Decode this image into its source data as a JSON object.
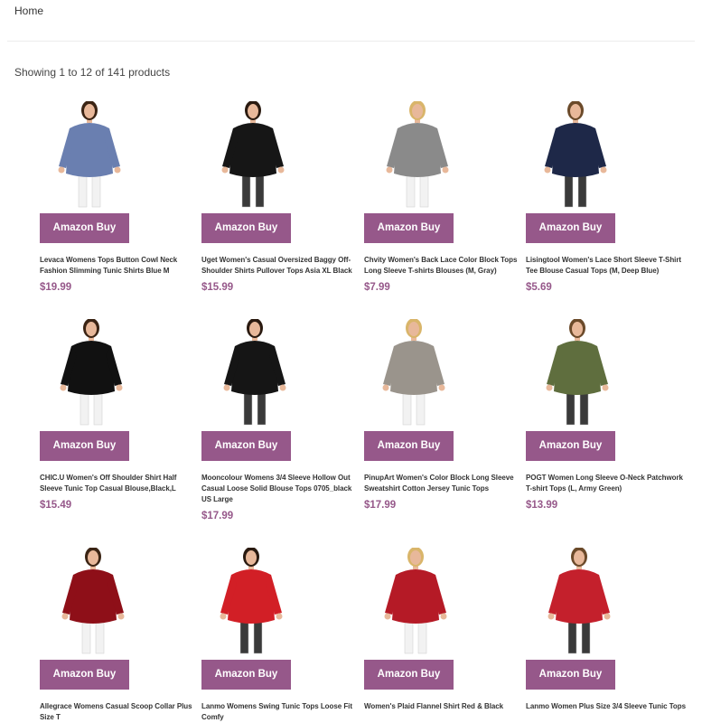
{
  "breadcrumb": {
    "home": "Home"
  },
  "results": {
    "summary": "Showing 1 to 12 of 141 products"
  },
  "buy_label": "Amazon Buy",
  "colors": {
    "accent": "#96588a"
  },
  "products": [
    {
      "title": "Levaca Womens Tops Button Cowl Neck Fashion Slimming Tunic Shirts Blue M",
      "price": "$19.99",
      "shirt_color": "#6a7fb0"
    },
    {
      "title": "Uget Women's Casual Oversized Baggy Off-Shoulder Shirts Pullover Tops Asia XL Black",
      "price": "$15.99",
      "shirt_color": "#161616"
    },
    {
      "title": "Chvity Women's Back Lace Color Block Tops Long Sleeve T-shirts Blouses (M, Gray)",
      "price": "$7.99",
      "shirt_color": "#8a8a8a"
    },
    {
      "title": "Lisingtool Women's Lace Short Sleeve T-Shirt Tee Blouse Casual Tops (M, Deep Blue)",
      "price": "$5.69",
      "shirt_color": "#1e2848"
    },
    {
      "title": "CHIC.U Women's Off Shoulder Shirt Half Sleeve Tunic Top Casual Blouse,Black,L",
      "price": "$15.49",
      "shirt_color": "#111111"
    },
    {
      "title": "Mooncolour Womens 3/4 Sleeve Hollow Out Casual Loose Solid Blouse Tops 0705_black US Large",
      "price": "$17.99",
      "shirt_color": "#151515"
    },
    {
      "title": "PinupArt Women's Color Block Long Sleeve Sweatshirt Cotton Jersey Tunic Tops",
      "price": "$17.99",
      "shirt_color": "#9a948c"
    },
    {
      "title": "POGT Women Long Sleeve O-Neck Patchwork T-shirt Tops (L, Army Green)",
      "price": "$13.99",
      "shirt_color": "#5f6e3e"
    },
    {
      "title": "Allegrace Womens Casual Scoop Collar Plus Size T",
      "price": "",
      "shirt_color": "#8e0f18"
    },
    {
      "title": "Lanmo Womens Swing Tunic Tops Loose Fit Comfy",
      "price": "",
      "shirt_color": "#d21f26"
    },
    {
      "title": "Women's Plaid Flannel Shirt Red & Black",
      "price": "",
      "shirt_color": "#b51a26"
    },
    {
      "title": "Lanmo Women Plus Size 3/4 Sleeve Tunic Tops",
      "price": "",
      "shirt_color": "#c4202c"
    }
  ]
}
